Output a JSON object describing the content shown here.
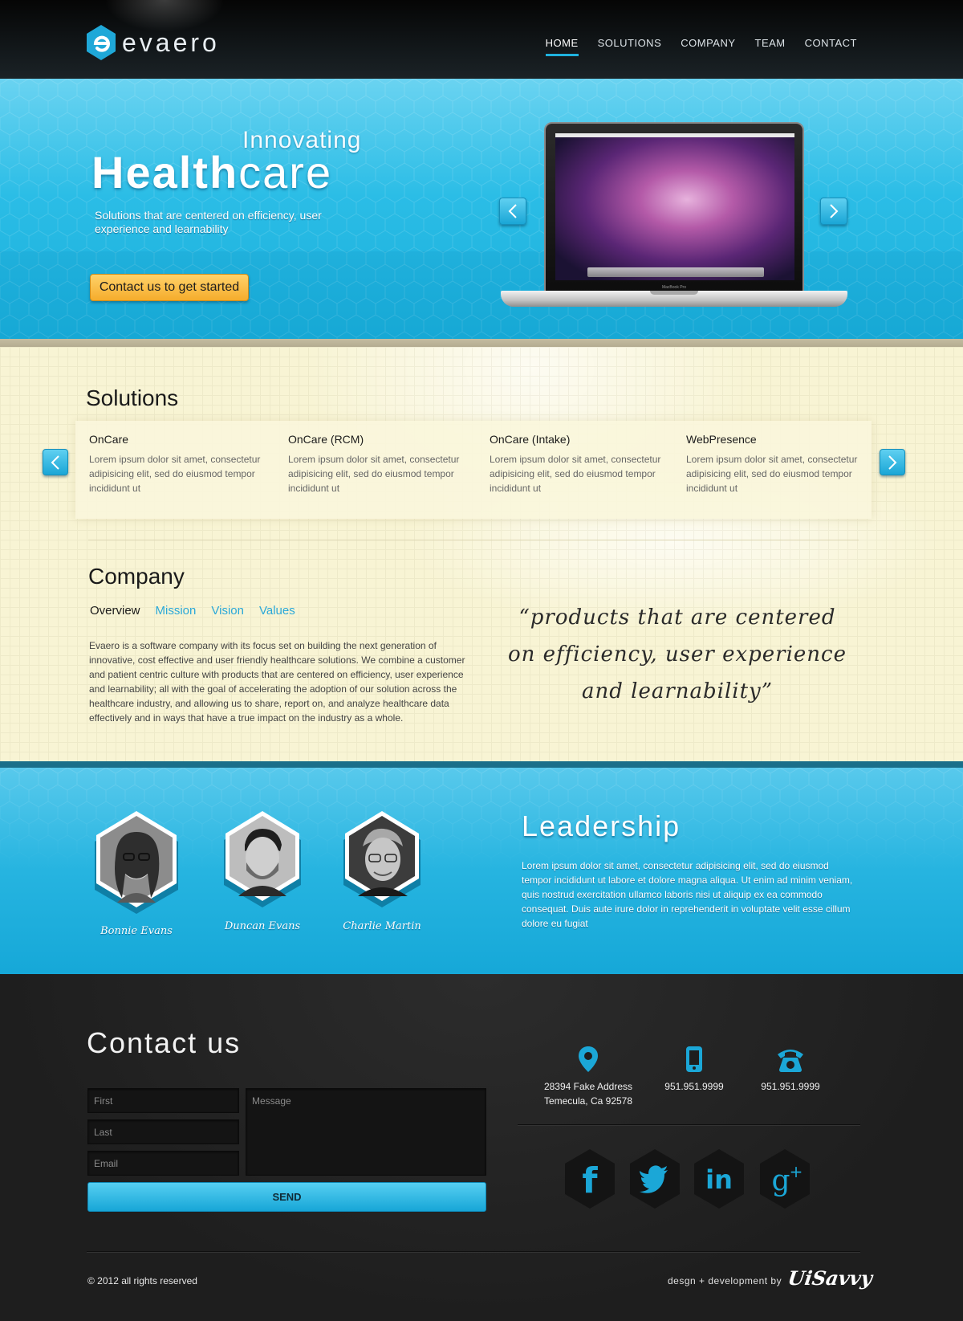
{
  "header": {
    "logo_text": "evaero",
    "nav": [
      {
        "label": "HOME"
      },
      {
        "label": "SOLUTIONS"
      },
      {
        "label": "COMPANY"
      },
      {
        "label": "TEAM"
      },
      {
        "label": "CONTACT"
      }
    ],
    "active_nav": "HOME",
    "accent_color": "#1fb2de"
  },
  "hero": {
    "subtitle": "Innovating",
    "title_bold": "Health",
    "title_light": "care",
    "description": "Solutions that are centered on efficiency, user experience and learnability",
    "cta_label": "Contact us to get started",
    "laptop_label": "MacBook Pro",
    "prev_icon": "chevron-left-icon",
    "next_icon": "chevron-right-icon"
  },
  "solutions": {
    "heading": "Solutions",
    "items": [
      {
        "title": "OnCare",
        "text": "Lorem ipsum dolor sit amet, consectetur adipisicing elit, sed do eiusmod tempor incididunt ut"
      },
      {
        "title": "OnCare (RCM)",
        "text": "Lorem ipsum dolor sit amet, consectetur adipisicing elit, sed do eiusmod tempor incididunt ut"
      },
      {
        "title": "OnCare (Intake)",
        "text": "Lorem ipsum dolor sit amet, consectetur adipisicing elit, sed do eiusmod tempor incididunt ut"
      },
      {
        "title": "WebPresence",
        "text": "Lorem ipsum dolor sit amet, consectetur adipisicing elit, sed do eiusmod tempor incididunt ut"
      }
    ]
  },
  "company": {
    "heading": "Company",
    "tabs": [
      {
        "label": "Overview"
      },
      {
        "label": "Mission"
      },
      {
        "label": "Vision"
      },
      {
        "label": "Values"
      }
    ],
    "active_tab": "Overview",
    "text": "Evaero is a software company with its focus set on building the next generation of innovative, cost effective and user friendly healthcare solutions. We combine a customer and patient centric culture with products that are centered on efficiency, user experience and learnability; all with the goal of accelerating the adoption of our solution across the healthcare industry, and allowing us to share, report on, and analyze healthcare data effectively and in ways that have a true impact on the industry as a whole.",
    "quote": "“products that are centered on efficiency, user experience and learnability”"
  },
  "leadership": {
    "heading": "Leadership",
    "text": "Lorem ipsum dolor sit amet, consectetur adipisicing elit, sed do eiusmod tempor incididunt ut labore et dolore magna aliqua. Ut enim ad minim veniam, quis nostrud exercitation ullamco laboris nisi ut aliquip ex ea commodo consequat. Duis aute irure dolor in reprehenderit in voluptate velit esse cillum dolore eu fugiat",
    "people": [
      {
        "name": "Bonnie Evans"
      },
      {
        "name": "Duncan Evans"
      },
      {
        "name": "Charlie Martin"
      }
    ]
  },
  "contact": {
    "heading": "Contact us",
    "first_placeholder": "First",
    "last_placeholder": "Last",
    "email_placeholder": "Email",
    "message_placeholder": "Message",
    "send_label": "SEND",
    "address_line1": "28394 Fake Address",
    "address_line2": "Temecula, Ca 92578",
    "mobile": "951.951.9999",
    "phone": "951.951.9999",
    "social": [
      {
        "icon": "facebook-icon"
      },
      {
        "icon": "twitter-icon"
      },
      {
        "icon": "linkedin-icon"
      },
      {
        "icon": "google-plus-icon"
      }
    ]
  },
  "footer": {
    "copyright": "© 2012 all rights reserved",
    "credit": "desgn + development by",
    "signature": "UiSavvy"
  }
}
